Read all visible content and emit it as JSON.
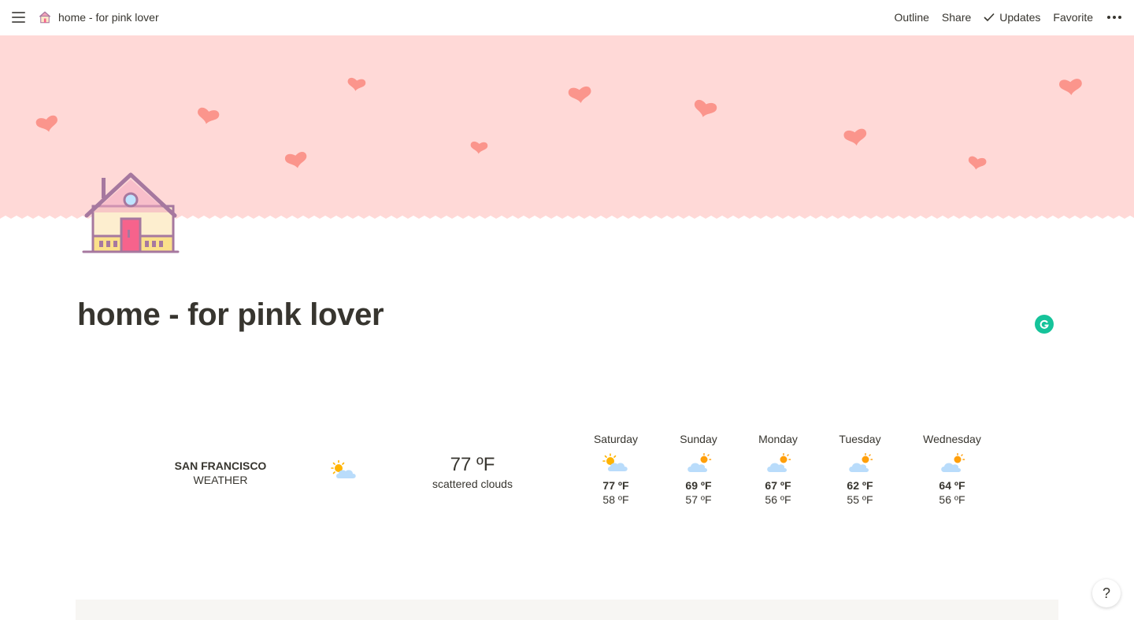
{
  "topbar": {
    "breadcrumb_title": "home - for pink lover",
    "actions": [
      "Outline",
      "Share",
      "Updates",
      "Favorite"
    ]
  },
  "page": {
    "title": "home - for pink lover",
    "cover_color": "#ffd9d7",
    "heart_color": "#fb958c"
  },
  "weather": {
    "city": "SAN FRANCISCO",
    "label": "WEATHER",
    "current_temp": "77 ºF",
    "current_desc": "scattered clouds",
    "current_icon": "sun-behind-cloud-icon",
    "forecast": [
      {
        "day": "Saturday",
        "high": "77 ºF",
        "low": "58 ºF",
        "icon": "sun-behind-cloud-icon"
      },
      {
        "day": "Sunday",
        "high": "69 ºF",
        "low": "57 ºF",
        "icon": "cloud-sun-icon"
      },
      {
        "day": "Monday",
        "high": "67 ºF",
        "low": "56 ºF",
        "icon": "cloud-sun-icon"
      },
      {
        "day": "Tuesday",
        "high": "62 ºF",
        "low": "55 ºF",
        "icon": "cloud-sun-icon"
      },
      {
        "day": "Wednesday",
        "high": "64 ºF",
        "low": "56 ºF",
        "icon": "cloud-sun-icon"
      }
    ]
  },
  "help_label": "?"
}
